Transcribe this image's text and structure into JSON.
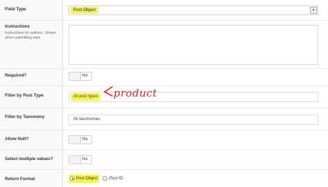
{
  "fields": {
    "field_type": {
      "label": "Field Type",
      "value": "Post Object"
    },
    "instructions": {
      "label": "Instructions",
      "description": "Instructions for authors. Shown when submitting data",
      "value": ""
    },
    "required": {
      "label": "Required?",
      "toggle": "No"
    },
    "filter_post_type": {
      "label": "Filter by Post Type",
      "value": "All post types"
    },
    "filter_taxonomy": {
      "label": "Filter by Taxonomy",
      "value": "All taxonomies"
    },
    "allow_null": {
      "label": "Allow Null?",
      "toggle": "No"
    },
    "multiple": {
      "label": "Select multiple values?",
      "toggle": "No"
    },
    "return_format": {
      "label": "Return Format",
      "options": [
        "Post Object",
        "Post ID"
      ],
      "selected": "Post Object"
    }
  },
  "annotation": {
    "text": "product",
    "color": "#e02020"
  },
  "colors": {
    "highlight": "#f7f74a",
    "label_bg": "#f9f9f9"
  }
}
